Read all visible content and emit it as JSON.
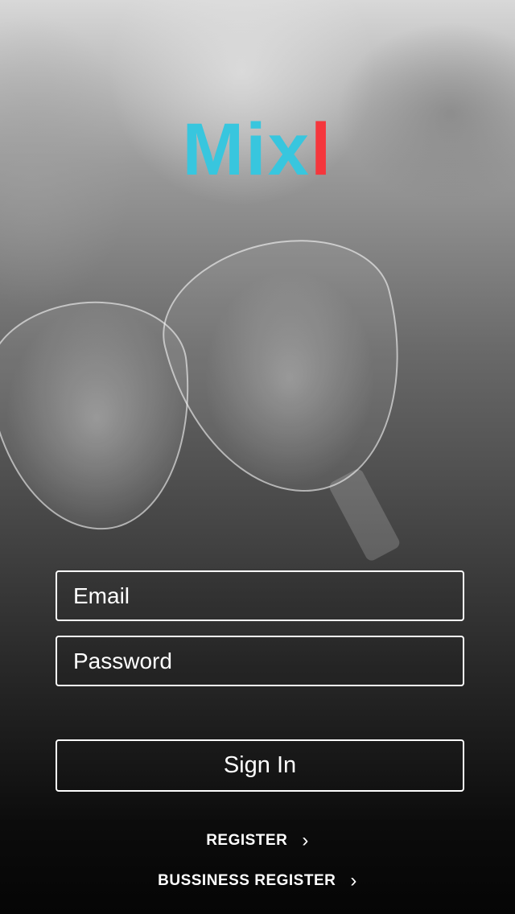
{
  "logo": {
    "part1": "Mix",
    "part2": "l",
    "brand_blue": "#38c6de",
    "brand_red": "#f5363c"
  },
  "form": {
    "email_placeholder": "Email",
    "password_placeholder": "Password",
    "signin_label": "Sign In"
  },
  "links": {
    "register_label": "REGISTER",
    "business_register_label": "BUSSINESS REGISTER",
    "chevron_icon": "chevron-right-icon"
  }
}
